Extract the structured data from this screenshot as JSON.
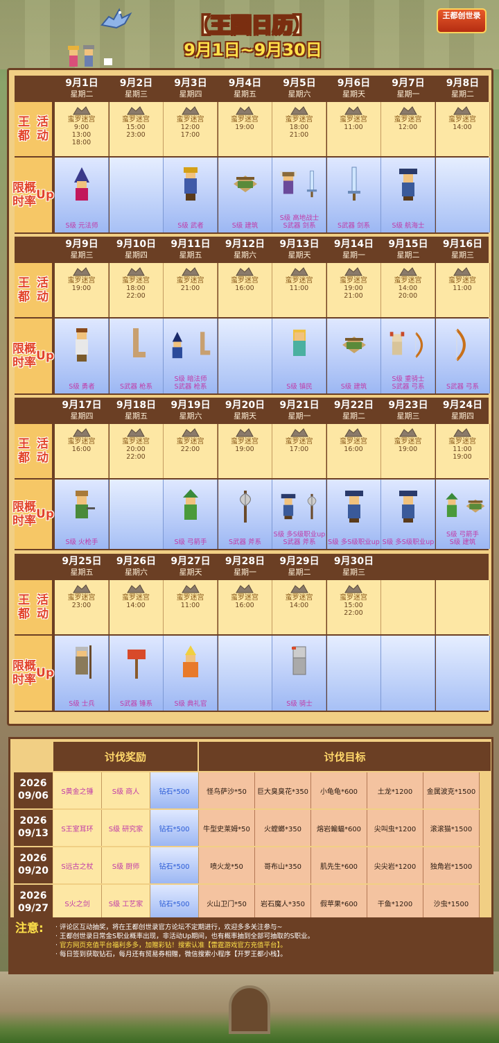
{
  "header": {
    "title": "【王国日历",
    "title_end": "】",
    "subtitle": "9月1日~9月30日",
    "logo_text": "王都创世录"
  },
  "labels": {
    "activity": "王都活动",
    "up": "限时概率Up",
    "activity_lines": [
      "王都",
      "活动"
    ],
    "up_lines": [
      "限时",
      "概率",
      "Up"
    ]
  },
  "weeks": [
    {
      "days": [
        {
          "date": "9月1日",
          "wd": "星期二",
          "act": "蛮罗迷宫",
          "times": [
            "9:00",
            "13:00",
            "18:00"
          ],
          "up": "S级 元法师",
          "sprites": [
            "wizard-sprite"
          ]
        },
        {
          "date": "9月2日",
          "wd": "星期三",
          "act": "蛮罗迷宫",
          "times": [
            "15:00",
            "23:00"
          ],
          "up": "",
          "sprites": []
        },
        {
          "date": "9月3日",
          "wd": "星期四",
          "act": "蛮罗迷宫",
          "times": [
            "12:00",
            "17:00"
          ],
          "up": "S级 武者",
          "sprites": [
            "samurai-sprite"
          ]
        },
        {
          "date": "9月4日",
          "wd": "星期五",
          "act": "蛮罗迷宫",
          "times": [
            "19:00"
          ],
          "up": "S级 建筑",
          "sprites": [
            "building-sprite"
          ]
        },
        {
          "date": "9月5日",
          "wd": "星期六",
          "act": "蛮罗迷宫",
          "times": [
            "18:00",
            "21:00"
          ],
          "up": "S级 高地战士\nS武器 剑系",
          "sprites": [
            "viking-sprite",
            "sword-sprite"
          ]
        },
        {
          "date": "9月6日",
          "wd": "星期天",
          "act": "蛮罗迷宫",
          "times": [
            "11:00"
          ],
          "up": "S武器 剑系",
          "sprites": [
            "sword-sprite"
          ]
        },
        {
          "date": "9月7日",
          "wd": "星期一",
          "act": "蛮罗迷宫",
          "times": [
            "12:00"
          ],
          "up": "S级 航海士",
          "sprites": [
            "pirate-sprite"
          ]
        },
        {
          "date": "9月8日",
          "wd": "星期二",
          "act": "蛮罗迷宫",
          "times": [
            "14:00"
          ],
          "up": "",
          "sprites": []
        }
      ]
    },
    {
      "days": [
        {
          "date": "9月9日",
          "wd": "星期三",
          "act": "蛮罗迷宫",
          "times": [
            "19:00"
          ],
          "up": "S级 勇者",
          "sprites": [
            "hero-sprite"
          ]
        },
        {
          "date": "9月10日",
          "wd": "星期四",
          "act": "蛮罗迷宫",
          "times": [
            "18:00",
            "22:00"
          ],
          "up": "S武器 枪系",
          "sprites": [
            "boot-sprite"
          ]
        },
        {
          "date": "9月11日",
          "wd": "星期五",
          "act": "蛮罗迷宫",
          "times": [
            "21:00"
          ],
          "up": "S级 暗法师\nS武器 枪系",
          "sprites": [
            "darkmage-sprite",
            "boot-sprite"
          ]
        },
        {
          "date": "9月12日",
          "wd": "星期六",
          "act": "蛮罗迷宫",
          "times": [
            "16:00"
          ],
          "up": "",
          "sprites": []
        },
        {
          "date": "9月13日",
          "wd": "星期天",
          "act": "蛮罗迷宫",
          "times": [
            "11:00"
          ],
          "up": "S级 镇民",
          "sprites": [
            "villager-sprite"
          ]
        },
        {
          "date": "9月14日",
          "wd": "星期一",
          "act": "蛮罗迷宫",
          "times": [
            "19:00",
            "21:00"
          ],
          "up": "S级 建筑",
          "sprites": [
            "building-sprite"
          ]
        },
        {
          "date": "9月15日",
          "wd": "星期二",
          "act": "蛮罗迷宫",
          "times": [
            "14:00",
            "20:00"
          ],
          "up": "S级 重骑士\nS武器 弓系",
          "sprites": [
            "knight-sprite",
            "bow-sprite"
          ]
        },
        {
          "date": "9月16日",
          "wd": "星期三",
          "act": "蛮罗迷宫",
          "times": [
            "11:00"
          ],
          "up": "S武器 弓系",
          "sprites": [
            "bow-sprite"
          ]
        }
      ]
    },
    {
      "days": [
        {
          "date": "9月17日",
          "wd": "星期四",
          "act": "蛮罗迷宫",
          "times": [
            "16:00"
          ],
          "up": "S级 火枪手",
          "sprites": [
            "gunner-sprite"
          ]
        },
        {
          "date": "9月18日",
          "wd": "星期五",
          "act": "蛮罗迷宫",
          "times": [
            "20:00",
            "22:00"
          ],
          "up": "",
          "sprites": []
        },
        {
          "date": "9月19日",
          "wd": "星期六",
          "act": "蛮罗迷宫",
          "times": [
            "22:00"
          ],
          "up": "S级 弓箭手",
          "sprites": [
            "archer-sprite"
          ]
        },
        {
          "date": "9月20日",
          "wd": "星期天",
          "act": "蛮罗迷宫",
          "times": [
            "19:00"
          ],
          "up": "S武器 斧系",
          "sprites": [
            "axe-sprite"
          ]
        },
        {
          "date": "9月21日",
          "wd": "星期一",
          "act": "蛮罗迷宫",
          "times": [
            "17:00"
          ],
          "up": "S级 多S级职业up\nS武器 斧系",
          "sprites": [
            "pirate-sprite",
            "axe-sprite"
          ]
        },
        {
          "date": "9月22日",
          "wd": "星期二",
          "act": "蛮罗迷宫",
          "times": [
            "16:00"
          ],
          "up": "S级 多S级职业up",
          "sprites": [
            "pirate-sprite"
          ]
        },
        {
          "date": "9月23日",
          "wd": "星期三",
          "act": "蛮罗迷宫",
          "times": [
            "19:00"
          ],
          "up": "S级 多S级职业up",
          "sprites": [
            "pirate-sprite"
          ]
        },
        {
          "date": "9月24日",
          "wd": "星期四",
          "act": "蛮罗迷宫",
          "times": [
            "11:00",
            "19:00"
          ],
          "up": "S级 弓箭手\nS级 建筑",
          "sprites": [
            "archer-sprite",
            "building-sprite"
          ]
        }
      ]
    },
    {
      "days": [
        {
          "date": "9月25日",
          "wd": "星期五",
          "act": "蛮罗迷宫",
          "times": [
            "23:00"
          ],
          "up": "S级 士兵",
          "sprites": [
            "soldier-sprite"
          ]
        },
        {
          "date": "9月26日",
          "wd": "星期六",
          "act": "蛮罗迷宫",
          "times": [
            "14:00"
          ],
          "up": "S武器 锤系",
          "sprites": [
            "hammer-sprite"
          ]
        },
        {
          "date": "9月27日",
          "wd": "星期天",
          "act": "蛮罗迷宫",
          "times": [
            "11:00"
          ],
          "up": "S级 典礼官",
          "sprites": [
            "bishop-sprite"
          ]
        },
        {
          "date": "9月28日",
          "wd": "星期一",
          "act": "蛮罗迷宫",
          "times": [
            "16:00"
          ],
          "up": "",
          "sprites": []
        },
        {
          "date": "9月29日",
          "wd": "星期二",
          "act": "蛮罗迷宫",
          "times": [
            "14:00"
          ],
          "up": "S级 骑士",
          "sprites": [
            "armor-sprite"
          ]
        },
        {
          "date": "9月30日",
          "wd": "星期三",
          "act": "蛮罗迷宫",
          "times": [
            "15:00",
            "22:00"
          ],
          "up": "",
          "sprites": []
        },
        {
          "date": "",
          "wd": "",
          "act": "",
          "times": [],
          "up": "",
          "sprites": []
        },
        {
          "date": "",
          "wd": "",
          "act": "",
          "times": [],
          "up": "",
          "sprites": []
        }
      ]
    }
  ],
  "rewards": {
    "head_reward": "讨伐奖励",
    "head_target": "讨伐目标",
    "rows": [
      {
        "year": "2026",
        "md": "09/06",
        "r": [
          "S黄金之锤",
          "S级 商人",
          "钻石*500"
        ],
        "t": [
          "怪鸟萨沙*50",
          "巨大臭臭花*350",
          "小龟龟*600",
          "土龙*1200",
          "金属波克*1500"
        ]
      },
      {
        "year": "2026",
        "md": "09/13",
        "r": [
          "S王室耳环",
          "S级 研究家",
          "钻石*500"
        ],
        "t": [
          "牛型史莱姆*50",
          "火螳螂*350",
          "熔岩蝙蝠*600",
          "尖叫虫*1200",
          "滚滚猫*1500"
        ]
      },
      {
        "year": "2026",
        "md": "09/20",
        "r": [
          "S远古之杖",
          "S级 厨师",
          "钻石*500"
        ],
        "t": [
          "喷火龙*50",
          "哥布山*350",
          "肌先生*600",
          "尖尖岩*1200",
          "独角岩*1500"
        ]
      },
      {
        "year": "2026",
        "md": "09/27",
        "r": [
          "S火之剑",
          "S级 工艺家",
          "钻石*500"
        ],
        "t": [
          "火山卫门*50",
          "岩石魔人*350",
          "假苹果*600",
          "干鱼*1200",
          "沙虫*1500"
        ]
      }
    ]
  },
  "notes": {
    "label": "注意:",
    "lines": [
      "评论区互动抽奖，将在王都创世录官方论坛不定期进行，欢迎多多关注参与~",
      "王都创世录日常金S职业概率出现，非活动Up期间，也有概率抽到全部可抽取的S职业。",
      "官方网页充值平台福利多多，加赠彩钻！搜索认准【雷霆游戏官方充值平台】。",
      "每日签到获取钻石，每月还有贸易券相赠，微信搜索小程序【开罗王都小栈】。"
    ]
  },
  "colors": {
    "frame": "#6b3f24",
    "panel": "#f1cf84",
    "activity_cell": "#fde7a4",
    "up_cell": "#9cb7f3",
    "caption": "#c03ba8",
    "label": "#e2432a",
    "target_cell": "#f4c3a0"
  }
}
